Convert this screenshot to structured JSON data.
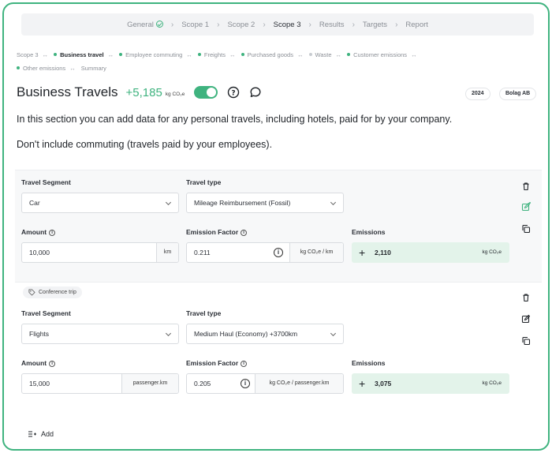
{
  "stepper": {
    "steps": [
      "General",
      "Scope 1",
      "Scope 2",
      "Scope 3",
      "Results",
      "Targets",
      "Report"
    ],
    "current": "Scope 3"
  },
  "breadcrumb": [
    "Scope 3",
    "Business travel",
    "Employee commuting",
    "Freights",
    "Purchased goods",
    "Waste",
    "Customer emissions",
    "Other emissions",
    "Summary"
  ],
  "header": {
    "title": "Business Travels",
    "total": "+5,185",
    "total_unit": "kg CO₂e",
    "year": "2024",
    "company": "Bolag AB"
  },
  "intro": {
    "line1": "In this section you can add data for any personal travels, including hotels, paid for by your company.",
    "line2": "Don't include commuting (travels paid by your employees)."
  },
  "labels": {
    "segment": "Travel Segment",
    "type": "Travel type",
    "amount": "Amount",
    "factor": "Emission Factor",
    "emissions": "Emissions"
  },
  "rows": [
    {
      "segment": "Car",
      "type": "Mileage Reimbursement (Fossil)",
      "amount": "10,000",
      "amount_unit": "km",
      "factor": "0.211",
      "factor_unit": "kg CO₂e / km",
      "emissions": "2,110",
      "emissions_unit": "kg CO₂e"
    },
    {
      "tag": "Conference trip",
      "segment": "Flights",
      "type": "Medium Haul (Economy) +3700km",
      "amount": "15,000",
      "amount_unit": "passenger.km",
      "factor": "0.205",
      "factor_unit": "kg CO₂e / passenger.km",
      "emissions": "3,075",
      "emissions_unit": "kg CO₂e"
    }
  ],
  "add_label": "Add",
  "colors": {
    "accent": "#3fb37f",
    "emission_bg": "#e3f3ea",
    "frame": "#3fb37f"
  }
}
